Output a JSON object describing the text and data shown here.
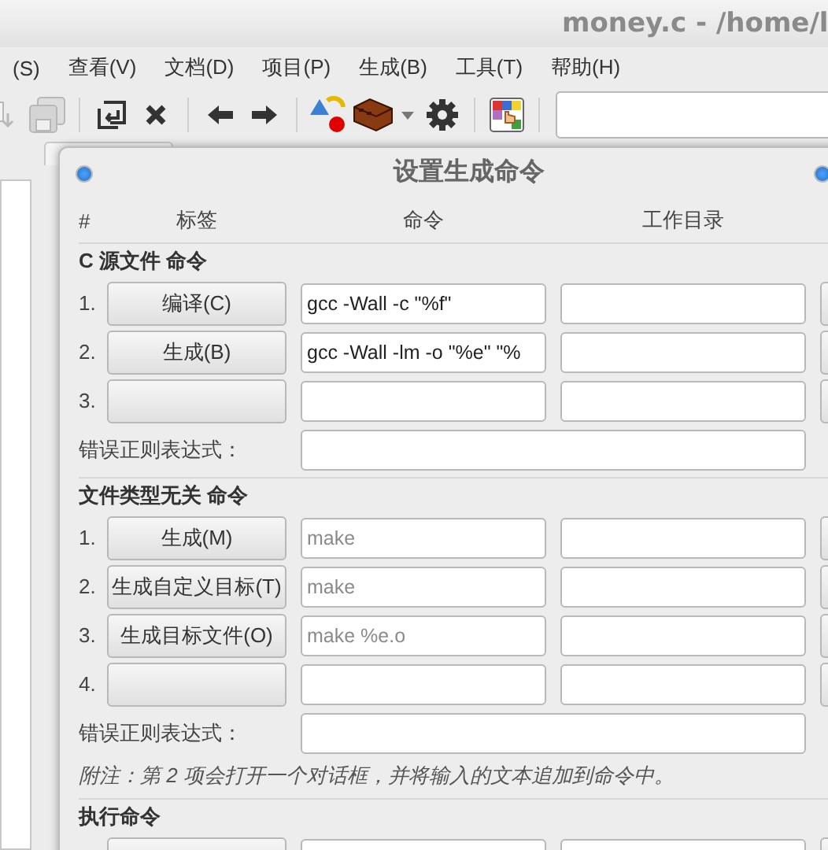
{
  "window": {
    "title": "money.c - /home/l"
  },
  "menu": [
    "(S)",
    "查看(V)",
    "文档(D)",
    "项目(P)",
    "生成(B)",
    "工具(T)",
    "帮助(H)"
  ],
  "toolbar": [
    {
      "kind": "new",
      "disabled": true
    },
    {
      "kind": "save",
      "disabled": true
    },
    {
      "kind": "sep"
    },
    {
      "kind": "revert",
      "disabled": false
    },
    {
      "kind": "close",
      "disabled": false
    },
    {
      "kind": "sep"
    },
    {
      "kind": "back",
      "disabled": false
    },
    {
      "kind": "forward",
      "disabled": false
    },
    {
      "kind": "sep"
    },
    {
      "kind": "compile",
      "disabled": false
    },
    {
      "kind": "build",
      "disabled": false
    },
    {
      "kind": "caret",
      "disabled": false
    },
    {
      "kind": "gear",
      "disabled": false
    },
    {
      "kind": "sep"
    },
    {
      "kind": "color",
      "disabled": false
    },
    {
      "kind": "sep"
    },
    {
      "kind": "search"
    }
  ],
  "dialog": {
    "title": "设置生成命令",
    "columns": [
      "#",
      "标签",
      "命令",
      "工作目录"
    ],
    "sections": [
      {
        "title": "C 源文件 命令",
        "rows": [
          {
            "number": "1.",
            "label": "编译(C)",
            "command": "gcc -Wall -c \"%f\""
          },
          {
            "number": "2.",
            "label": "生成(B)",
            "command": "gcc -Wall -lm -o \"%e\" \"%"
          },
          {
            "number": "3."
          }
        ],
        "regex_label": "错误正则表达式："
      },
      {
        "title": "文件类型无关 命令",
        "rows": [
          {
            "number": "1.",
            "label": "生成(M)",
            "placeholder": "make"
          },
          {
            "number": "2.",
            "label": "生成自定义目标(T)",
            "placeholder": "make"
          },
          {
            "number": "3.",
            "label": "生成目标文件(O)",
            "placeholder": "make %e.o"
          },
          {
            "number": "4."
          }
        ],
        "regex_label": "错误正则表达式：",
        "note": "附注：第 2 项会打开一个对话框，并将输入的文本追加到命令中。"
      },
      {
        "title": "执行命令",
        "rows": [
          {}
        ]
      }
    ]
  }
}
